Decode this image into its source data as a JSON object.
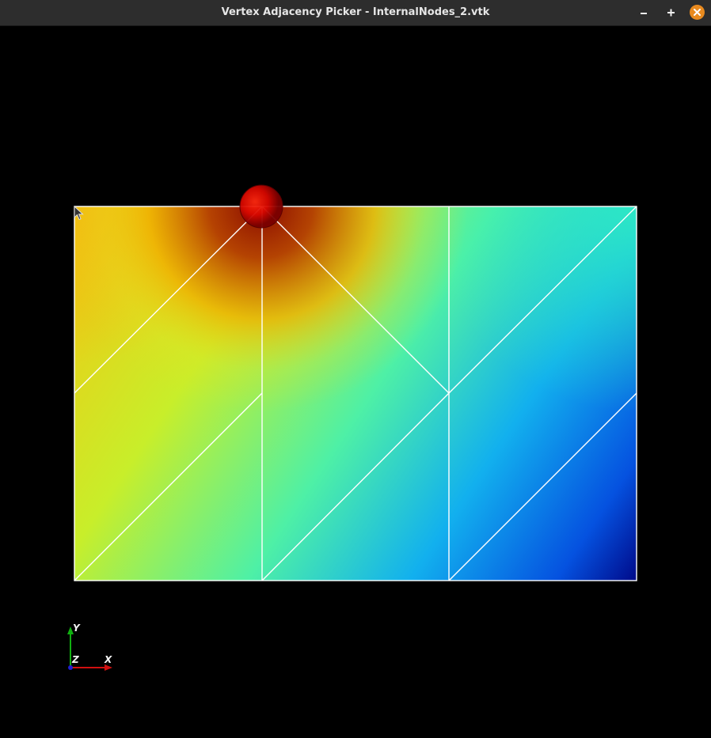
{
  "window": {
    "title": "Vertex Adjacency Picker - InternalNodes_2.vtk",
    "buttons": {
      "minimize": "minimize-icon",
      "maximize": "plus-icon",
      "close": "close-icon"
    },
    "close_color": "#e88a1f"
  },
  "scene": {
    "background": "#000000",
    "mesh": {
      "wireframe_color": "#ffffff",
      "colormap": "jet",
      "selected_vertex_color": "#e00000"
    },
    "orientation_axes": {
      "y_label": "Y",
      "z_label": "Z",
      "x_label": "X",
      "x_color": "#d01010",
      "y_color": "#10b010",
      "z_color": "#2020d0"
    }
  }
}
